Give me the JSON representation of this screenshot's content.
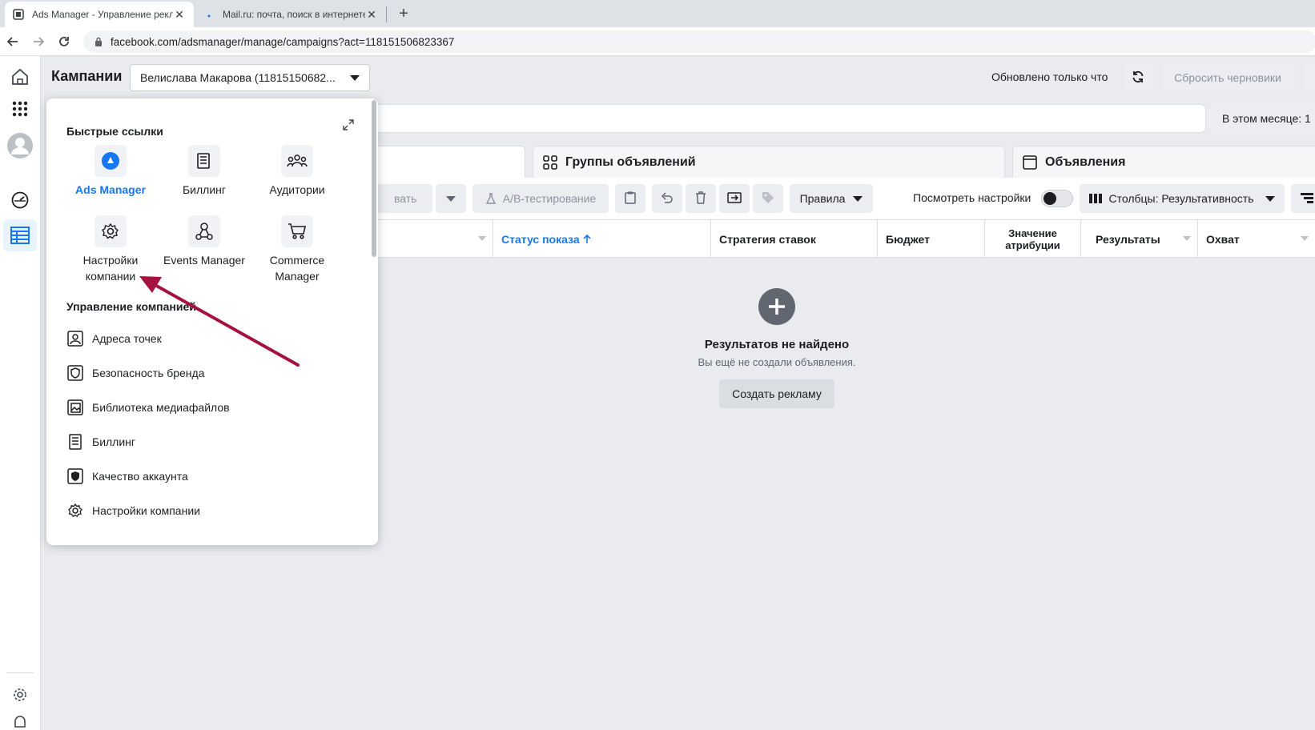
{
  "browser": {
    "tabs": [
      {
        "title": "Ads Manager - Управление рекламой",
        "active": true
      },
      {
        "title": "Mail.ru: почта, поиск в интернете",
        "active": false
      }
    ],
    "url": "facebook.com/adsmanager/manage/campaigns?act=118151506823367"
  },
  "header": {
    "title": "Кампании",
    "account": "Велислава Макарова (11815150682...",
    "updated": "Обновлено только что",
    "reset_label": "Сбросить черновики",
    "month_label": "В этом месяце: 1"
  },
  "levels": [
    {
      "label": "Группы объявлений",
      "icon": "adsets-icon"
    },
    {
      "label": "Объявления",
      "icon": "ads-icon"
    }
  ],
  "actions": {
    "edit_partial": "вать",
    "ab_test": "A/B-тестирование",
    "rules": "Правила",
    "view_settings": "Посмотреть настройки",
    "columns": "Столбцы: Результативность"
  },
  "table": {
    "columns": [
      "Статус показа",
      "Стратегия ставок",
      "Бюджет",
      "Значение атрибуции",
      "Результаты",
      "Охват"
    ]
  },
  "empty": {
    "title": "Результатов не найдено",
    "subtitle": "Вы ещё не создали объявления.",
    "button": "Создать рекламу"
  },
  "popup": {
    "quick_links_title": "Быстрые ссылки",
    "quick_links": [
      {
        "label": "Ads Manager",
        "icon": "ads-manager-icon"
      },
      {
        "label": "Биллинг",
        "icon": "billing-icon"
      },
      {
        "label": "Аудитории",
        "icon": "audiences-icon"
      },
      {
        "label": "Настройки компании",
        "icon": "gear-icon"
      },
      {
        "label": "Events Manager",
        "icon": "events-manager-icon"
      },
      {
        "label": "Commerce Manager",
        "icon": "cart-icon"
      }
    ],
    "manage_title": "Управление компанией",
    "manage_items": [
      {
        "label": "Адреса точек",
        "icon": "location-icon"
      },
      {
        "label": "Безопасность бренда",
        "icon": "shield-icon"
      },
      {
        "label": "Библиотека медиафайлов",
        "icon": "media-library-icon"
      },
      {
        "label": "Биллинг",
        "icon": "billing-icon"
      },
      {
        "label": "Качество аккаунта",
        "icon": "account-quality-icon"
      },
      {
        "label": "Настройки компании",
        "icon": "gear-icon"
      }
    ]
  },
  "colors": {
    "accent": "#1877f2",
    "annotation_arrow": "#a5123f"
  }
}
